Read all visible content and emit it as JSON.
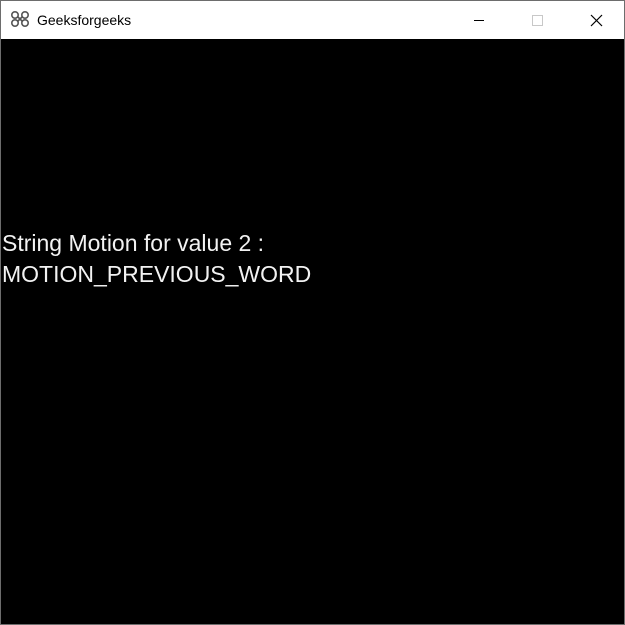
{
  "window": {
    "title": "Geeksforgeeks",
    "icon": "gtk-app-icon"
  },
  "controls": {
    "minimize_icon": "minimize-icon",
    "maximize_icon": "maximize-icon",
    "close_icon": "close-icon"
  },
  "content": {
    "line1": "String Motion for value 2 :",
    "line2": "MOTION_PREVIOUS_WORD"
  },
  "colors": {
    "titlebar_bg": "#ffffff",
    "content_bg": "#000000",
    "text": "#f2f2f2"
  }
}
